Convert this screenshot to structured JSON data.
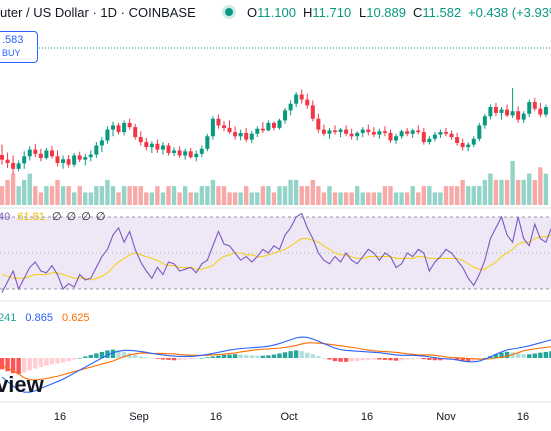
{
  "header": {
    "symbol_line": "uter / US Dollar · 1D · COINBASE",
    "o_label": "O",
    "o_value": "11.100",
    "h_label": "H",
    "h_value": "11.710",
    "l_label": "L",
    "l_value": "10.889",
    "c_label": "C",
    "c_value": "11.582",
    "change": "+0.438 (+3.93%)"
  },
  "buy_box": {
    "price": ".583",
    "label": "BUY"
  },
  "rsi_legend": {
    "v1": "40",
    "v2": "61.81",
    "extras": [
      "∅",
      "∅",
      "∅",
      "∅"
    ]
  },
  "macd_legend": {
    "v1": "241",
    "v2": "0.865",
    "v3": "0.625"
  },
  "watermark": "view",
  "x_axis": [
    "16",
    "Sep",
    "16",
    "Oct",
    "16",
    "Nov",
    "16"
  ],
  "colors": {
    "up": "#089981",
    "down": "#f23645",
    "rsi": "#7e57c2",
    "rsi_ma": "#f5d11b",
    "macd": "#2962ff",
    "signal": "#ff6d00",
    "rsi_band": "#ede7f6"
  },
  "chart_data": [
    {
      "type": "candlestick",
      "title": "uter / US Dollar · 1D · COINBASE",
      "x_ticks": [
        "16",
        "Sep",
        "16",
        "Oct",
        "16",
        "Nov",
        "16"
      ],
      "note": "values approximate (price, no y-axis labels visible); volume shown as bars beneath",
      "candles": [
        [
          9.25,
          9.5,
          9.02,
          9.14
        ],
        [
          9.14,
          9.31,
          8.94,
          9.06
        ],
        [
          9.06,
          9.24,
          8.79,
          8.92
        ],
        [
          8.92,
          9.12,
          8.86,
          9.05
        ],
        [
          9.05,
          9.34,
          8.92,
          9.22
        ],
        [
          9.22,
          9.46,
          9.12,
          9.38
        ],
        [
          9.38,
          9.52,
          9.2,
          9.28
        ],
        [
          9.28,
          9.4,
          9.1,
          9.18
        ],
        [
          9.18,
          9.42,
          9.14,
          9.36
        ],
        [
          9.36,
          9.47,
          9.17,
          9.22
        ],
        [
          9.22,
          9.36,
          8.98,
          9.06
        ],
        [
          9.06,
          9.24,
          8.92,
          9.15
        ],
        [
          9.15,
          9.25,
          8.95,
          9.02
        ],
        [
          9.02,
          9.3,
          8.96,
          9.24
        ],
        [
          9.24,
          9.33,
          9.08,
          9.14
        ],
        [
          9.14,
          9.28,
          9.0,
          9.2
        ],
        [
          9.2,
          9.36,
          9.1,
          9.26
        ],
        [
          9.26,
          9.56,
          9.18,
          9.48
        ],
        [
          9.48,
          9.68,
          9.32,
          9.6
        ],
        [
          9.6,
          9.94,
          9.52,
          9.86
        ],
        [
          9.86,
          10.05,
          9.7,
          9.96
        ],
        [
          9.96,
          10.02,
          9.74,
          9.8
        ],
        [
          9.8,
          10.08,
          9.72,
          10.02
        ],
        [
          10.02,
          10.12,
          9.86,
          9.92
        ],
        [
          9.92,
          10.0,
          9.62,
          9.68
        ],
        [
          9.68,
          9.82,
          9.48,
          9.56
        ],
        [
          9.56,
          9.66,
          9.36,
          9.44
        ],
        [
          9.44,
          9.58,
          9.3,
          9.52
        ],
        [
          9.52,
          9.62,
          9.3,
          9.38
        ],
        [
          9.38,
          9.56,
          9.26,
          9.48
        ],
        [
          9.48,
          9.54,
          9.24,
          9.3
        ],
        [
          9.3,
          9.44,
          9.22,
          9.36
        ],
        [
          9.36,
          9.46,
          9.18,
          9.24
        ],
        [
          9.24,
          9.4,
          9.14,
          9.34
        ],
        [
          9.34,
          9.42,
          9.16,
          9.2
        ],
        [
          9.2,
          9.36,
          9.1,
          9.28
        ],
        [
          9.28,
          9.48,
          9.2,
          9.4
        ],
        [
          9.4,
          9.76,
          9.34,
          9.7
        ],
        [
          9.7,
          10.18,
          9.62,
          10.12
        ],
        [
          10.12,
          10.22,
          9.88,
          9.96
        ],
        [
          9.96,
          10.06,
          9.82,
          9.9
        ],
        [
          9.9,
          10.08,
          9.76,
          9.8
        ],
        [
          9.8,
          9.94,
          9.62,
          9.7
        ],
        [
          9.7,
          9.86,
          9.6,
          9.78
        ],
        [
          9.78,
          9.9,
          9.56,
          9.62
        ],
        [
          9.62,
          9.82,
          9.54,
          9.76
        ],
        [
          9.76,
          9.94,
          9.68,
          9.88
        ],
        [
          9.88,
          10.04,
          9.78,
          9.84
        ],
        [
          9.84,
          10.08,
          9.82,
          10.02
        ],
        [
          10.02,
          10.06,
          9.84,
          9.9
        ],
        [
          9.9,
          10.12,
          9.86,
          10.08
        ],
        [
          10.08,
          10.38,
          10.0,
          10.32
        ],
        [
          10.32,
          10.56,
          10.2,
          10.48
        ],
        [
          10.48,
          10.76,
          10.4,
          10.7
        ],
        [
          10.7,
          10.82,
          10.48,
          10.58
        ],
        [
          10.58,
          10.72,
          10.36,
          10.44
        ],
        [
          10.44,
          10.56,
          10.06,
          10.12
        ],
        [
          10.12,
          10.24,
          9.78,
          9.86
        ],
        [
          9.86,
          9.98,
          9.7,
          9.76
        ],
        [
          9.76,
          9.9,
          9.64,
          9.84
        ],
        [
          9.84,
          9.96,
          9.74,
          9.8
        ],
        [
          9.8,
          9.9,
          9.68,
          9.86
        ],
        [
          9.86,
          9.96,
          9.7,
          9.76
        ],
        [
          9.76,
          9.88,
          9.62,
          9.7
        ],
        [
          9.7,
          9.82,
          9.6,
          9.78
        ],
        [
          9.78,
          9.92,
          9.68,
          9.86
        ],
        [
          9.86,
          9.98,
          9.72,
          9.8
        ],
        [
          9.8,
          9.92,
          9.68,
          9.74
        ],
        [
          9.74,
          9.88,
          9.64,
          9.82
        ],
        [
          9.82,
          9.94,
          9.7,
          9.78
        ],
        [
          9.78,
          9.86,
          9.54,
          9.6
        ],
        [
          9.6,
          9.76,
          9.52,
          9.7
        ],
        [
          9.7,
          9.86,
          9.64,
          9.82
        ],
        [
          9.82,
          9.9,
          9.7,
          9.76
        ],
        [
          9.76,
          9.88,
          9.66,
          9.84
        ],
        [
          9.84,
          9.96,
          9.74,
          9.8
        ],
        [
          9.8,
          9.9,
          9.5,
          9.56
        ],
        [
          9.56,
          9.7,
          9.5,
          9.64
        ],
        [
          9.64,
          9.8,
          9.58,
          9.74
        ],
        [
          9.74,
          9.86,
          9.66,
          9.8
        ],
        [
          9.8,
          9.9,
          9.7,
          9.76
        ],
        [
          9.76,
          9.84,
          9.62,
          9.68
        ],
        [
          9.68,
          9.78,
          9.48,
          9.54
        ],
        [
          9.54,
          9.64,
          9.36,
          9.44
        ],
        [
          9.44,
          9.56,
          9.34,
          9.5
        ],
        [
          9.5,
          9.7,
          9.44,
          9.64
        ],
        [
          9.64,
          10.02,
          9.58,
          9.96
        ],
        [
          9.96,
          10.24,
          9.88,
          10.18
        ],
        [
          10.18,
          10.46,
          10.1,
          10.4
        ],
        [
          10.4,
          10.5,
          10.18,
          10.26
        ],
        [
          10.26,
          10.4,
          10.1,
          10.34
        ],
        [
          10.34,
          10.46,
          10.16,
          10.2
        ],
        [
          10.2,
          10.86,
          10.14,
          10.3
        ],
        [
          10.3,
          10.42,
          10.02,
          10.1
        ],
        [
          10.1,
          10.3,
          10.02,
          10.24
        ],
        [
          10.24,
          10.58,
          10.16,
          10.52
        ],
        [
          10.52,
          10.62,
          10.3,
          10.36
        ],
        [
          10.36,
          10.5,
          10.16,
          10.22
        ],
        [
          10.22,
          10.46,
          10.16,
          10.4
        ]
      ],
      "volume": [
        3,
        4,
        5,
        3,
        4,
        5,
        3,
        2,
        3,
        3,
        4,
        3,
        3,
        2,
        3,
        2,
        2,
        3,
        3,
        4,
        3,
        2,
        3,
        3,
        3,
        3,
        2,
        2,
        3,
        2,
        3,
        3,
        2,
        3,
        2,
        2,
        3,
        3,
        4,
        3,
        3,
        2,
        2,
        2,
        3,
        2,
        2,
        3,
        3,
        2,
        3,
        3,
        4,
        4,
        3,
        3,
        4,
        3,
        2,
        3,
        2,
        2,
        2,
        2,
        3,
        2,
        2,
        2,
        2,
        3,
        3,
        2,
        2,
        2,
        3,
        2,
        3,
        3,
        2,
        2,
        3,
        3,
        3,
        4,
        3,
        3,
        3,
        4,
        5,
        4,
        4,
        4,
        7,
        4,
        4,
        5,
        4,
        6,
        5
      ]
    },
    {
      "type": "line",
      "title": "RSI",
      "series": [
        {
          "name": "RSI",
          "values": [
            28,
            34,
            40,
            30,
            36,
            42,
            45,
            40,
            39,
            43,
            38,
            30,
            33,
            31,
            38,
            35,
            36,
            42,
            48,
            52,
            60,
            64,
            56,
            62,
            52,
            45,
            40,
            36,
            42,
            38,
            45,
            44,
            40,
            41,
            42,
            39,
            44,
            46,
            54,
            62,
            55,
            54,
            50,
            46,
            48,
            45,
            48,
            52,
            50,
            54,
            52,
            60,
            64,
            70,
            72,
            64,
            58,
            50,
            46,
            44,
            48,
            45,
            50,
            46,
            44,
            48,
            52,
            50,
            46,
            50,
            48,
            42,
            44,
            50,
            48,
            52,
            50,
            40,
            45,
            48,
            52,
            50,
            46,
            42,
            36,
            32,
            38,
            46,
            58,
            64,
            70,
            60,
            56,
            70,
            58,
            54,
            66,
            58,
            56,
            64
          ]
        },
        {
          "name": "RSI-based MA",
          "values": [
            38,
            37,
            36,
            36,
            36,
            37,
            38,
            38,
            38,
            39,
            39,
            38,
            37,
            36,
            36,
            36,
            35,
            36,
            37,
            39,
            42,
            45,
            47,
            49,
            50,
            49,
            48,
            47,
            46,
            44,
            43,
            43,
            42,
            42,
            42,
            41,
            41,
            42,
            43,
            46,
            48,
            49,
            50,
            50,
            49,
            49,
            48,
            48,
            49,
            50,
            51,
            52,
            54,
            56,
            58,
            58,
            57,
            56,
            54,
            52,
            50,
            49,
            49,
            48,
            47,
            47,
            48,
            48,
            48,
            48,
            48,
            47,
            47,
            47,
            47,
            48,
            48,
            47,
            47,
            47,
            47,
            47,
            47,
            46,
            44,
            42,
            41,
            41,
            43,
            45,
            48,
            50,
            52,
            55,
            56,
            56,
            58,
            59,
            59,
            60
          ]
        }
      ]
    },
    {
      "type": "bar",
      "title": "MACD",
      "series": [
        {
          "name": "Histogram",
          "values": [
            -0.3,
            -0.35,
            -0.4,
            -0.42,
            -0.38,
            -0.33,
            -0.28,
            -0.24,
            -0.2,
            -0.17,
            -0.14,
            -0.12,
            -0.08,
            -0.04,
            0.0,
            0.04,
            0.08,
            0.12,
            0.16,
            0.2,
            0.22,
            0.2,
            0.16,
            0.12,
            0.08,
            0.04,
            0.02,
            0.0,
            -0.02,
            -0.04,
            -0.05,
            -0.06,
            -0.05,
            -0.04,
            -0.03,
            -0.02,
            0.0,
            0.02,
            0.04,
            0.06,
            0.08,
            0.09,
            0.1,
            0.09,
            0.08,
            0.07,
            0.06,
            0.06,
            0.07,
            0.09,
            0.12,
            0.15,
            0.18,
            0.2,
            0.18,
            0.14,
            0.1,
            0.05,
            0.0,
            -0.04,
            -0.08,
            -0.1,
            -0.1,
            -0.09,
            -0.08,
            -0.06,
            -0.05,
            -0.04,
            -0.04,
            -0.05,
            -0.06,
            -0.07,
            -0.06,
            -0.04,
            -0.03,
            -0.02,
            -0.03,
            -0.05,
            -0.06,
            -0.06,
            -0.05,
            -0.04,
            -0.06,
            -0.08,
            -0.09,
            -0.08,
            -0.05,
            0.0,
            0.05,
            0.1,
            0.14,
            0.16,
            0.15,
            0.12,
            0.1,
            0.1,
            0.12,
            0.14,
            0.16,
            0.18
          ]
        },
        {
          "name": "MACD",
          "values": [
            -0.5,
            -0.62,
            -0.74,
            -0.84,
            -0.9,
            -0.9,
            -0.86,
            -0.8,
            -0.74,
            -0.68,
            -0.62,
            -0.56,
            -0.48,
            -0.4,
            -0.32,
            -0.24,
            -0.16,
            -0.08,
            0.0,
            0.08,
            0.14,
            0.18,
            0.2,
            0.2,
            0.19,
            0.17,
            0.15,
            0.12,
            0.1,
            0.08,
            0.06,
            0.05,
            0.04,
            0.04,
            0.04,
            0.05,
            0.07,
            0.09,
            0.12,
            0.15,
            0.18,
            0.21,
            0.23,
            0.25,
            0.26,
            0.27,
            0.28,
            0.29,
            0.31,
            0.34,
            0.38,
            0.43,
            0.48,
            0.53,
            0.55,
            0.54,
            0.5,
            0.44,
            0.38,
            0.32,
            0.26,
            0.22,
            0.2,
            0.19,
            0.18,
            0.17,
            0.16,
            0.15,
            0.14,
            0.12,
            0.1,
            0.08,
            0.07,
            0.07,
            0.07,
            0.06,
            0.05,
            0.03,
            0.01,
            -0.01,
            -0.02,
            -0.03,
            -0.05,
            -0.08,
            -0.1,
            -0.1,
            -0.08,
            -0.03,
            0.03,
            0.1,
            0.16,
            0.21,
            0.24,
            0.26,
            0.29,
            0.32,
            0.36,
            0.4,
            0.44,
            0.48
          ]
        },
        {
          "name": "Signal",
          "values": [
            -0.2,
            -0.27,
            -0.34,
            -0.42,
            -0.52,
            -0.57,
            -0.58,
            -0.56,
            -0.54,
            -0.51,
            -0.48,
            -0.44,
            -0.4,
            -0.36,
            -0.32,
            -0.28,
            -0.24,
            -0.2,
            -0.16,
            -0.12,
            -0.08,
            -0.02,
            0.04,
            0.08,
            0.11,
            0.13,
            0.13,
            0.12,
            0.12,
            0.12,
            0.11,
            0.11,
            0.09,
            0.08,
            0.07,
            0.07,
            0.07,
            0.07,
            0.08,
            0.09,
            0.1,
            0.12,
            0.13,
            0.16,
            0.18,
            0.2,
            0.22,
            0.23,
            0.24,
            0.25,
            0.26,
            0.28,
            0.3,
            0.33,
            0.37,
            0.4,
            0.4,
            0.39,
            0.38,
            0.36,
            0.34,
            0.32,
            0.3,
            0.28,
            0.26,
            0.23,
            0.21,
            0.19,
            0.18,
            0.17,
            0.16,
            0.15,
            0.13,
            0.11,
            0.1,
            0.08,
            0.08,
            0.08,
            0.07,
            0.05,
            0.03,
            0.01,
            0.01,
            0.0,
            -0.01,
            -0.02,
            -0.03,
            -0.03,
            -0.02,
            0.0,
            0.02,
            0.05,
            0.09,
            0.14,
            0.19,
            0.22,
            0.24,
            0.26,
            0.28,
            0.3
          ]
        }
      ]
    }
  ]
}
